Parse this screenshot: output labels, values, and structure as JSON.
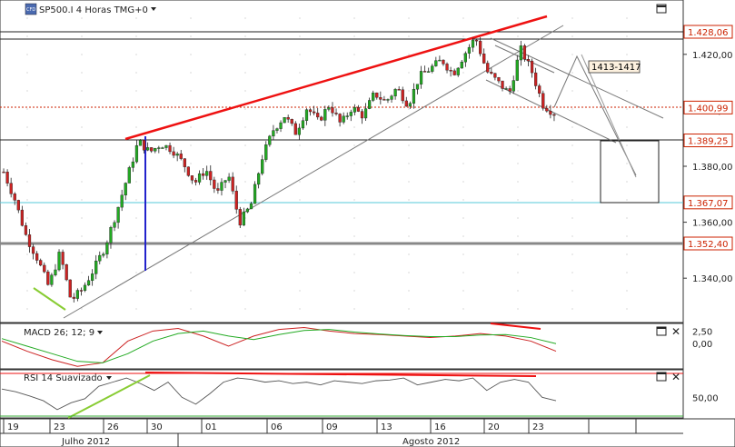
{
  "header": {
    "symbol_badge": "CFD",
    "title": "SP500.I 4 Horas TMG+0"
  },
  "annotation_box_label": "1413-1417",
  "price_tags": [
    {
      "value": "1.428,06",
      "color": "#cc2200"
    },
    {
      "value": "1.400,99",
      "color": "#cc2200"
    },
    {
      "value": "1.389,25",
      "color": "#cc2200"
    },
    {
      "value": "1.367,07",
      "color": "#cc2200"
    },
    {
      "value": "1.352,40",
      "color": "#cc2200"
    }
  ],
  "colors": {
    "bull": "#22aa22",
    "bear": "#cc2222",
    "trend_red": "#ee1111",
    "blue_line": "#2222cc",
    "divergence_green": "#88cc33",
    "cyan_line": "#55c8d8"
  },
  "chart_data": [
    {
      "type": "candlestick",
      "title": "SP500.I 4 Horas TMG+0",
      "y_ticks": [
        "1.420,00",
        "1.400,00",
        "1.380,00",
        "1.360,00",
        "1.340,00"
      ],
      "ylim": [
        1330,
        1432
      ],
      "x_ticks": [
        "19",
        "23",
        "26",
        "30",
        "01",
        "06",
        "09",
        "13",
        "16",
        "20",
        "23"
      ],
      "months": [
        "Julho 2012",
        "Agosto 2012"
      ],
      "horizontal_levels": [
        1428.06,
        1400.99,
        1389.25,
        1367.07,
        1352.4
      ],
      "price_path": [
        1378,
        1368,
        1355,
        1347,
        1337,
        1349,
        1332,
        1336,
        1343,
        1351,
        1363,
        1376,
        1389,
        1385,
        1388,
        1386,
        1381,
        1374,
        1379,
        1370,
        1377,
        1360,
        1366,
        1383,
        1393,
        1398,
        1392,
        1401,
        1396,
        1402,
        1395,
        1401,
        1398,
        1406,
        1403,
        1408,
        1402,
        1412,
        1415,
        1418,
        1413,
        1420,
        1426,
        1414,
        1410,
        1406,
        1422,
        1414,
        1402,
        1399
      ]
    },
    {
      "type": "line",
      "title": "MACD 26; 12; 9",
      "y_ticks": [
        "2,50",
        "0,00"
      ],
      "ylim": [
        -5,
        4
      ],
      "series": [
        {
          "values": [
            0.5,
            -1.5,
            -3.2,
            -4.5,
            -3.8,
            0.5,
            2.5,
            3.0,
            1.5,
            -0.5,
            1.5,
            2.8,
            3.2,
            2.5,
            2.0,
            1.8,
            1.5,
            1.2,
            1.5,
            2.0,
            1.5,
            0.5,
            -1.5
          ]
        },
        {
          "values": [
            1.0,
            -0.5,
            -2.0,
            -3.5,
            -3.8,
            -2.0,
            0.5,
            2.0,
            2.5,
            1.5,
            0.8,
            1.8,
            2.6,
            2.8,
            2.3,
            1.9,
            1.6,
            1.4,
            1.4,
            1.7,
            1.8,
            1.2,
            0.0
          ]
        }
      ]
    },
    {
      "type": "line",
      "title": "RSI 14 Suavizado",
      "y_ticks": [
        "50,00"
      ],
      "ylim": [
        20,
        90
      ],
      "series": [
        {
          "values": [
            62,
            58,
            52,
            45,
            32,
            42,
            48,
            66,
            72,
            78,
            70,
            60,
            72,
            50,
            40,
            55,
            72,
            78,
            76,
            72,
            74,
            70,
            72,
            68,
            74,
            72,
            70,
            74,
            75,
            78,
            68,
            72,
            76,
            74,
            78,
            60,
            72,
            76,
            72,
            50,
            45
          ]
        }
      ]
    }
  ]
}
